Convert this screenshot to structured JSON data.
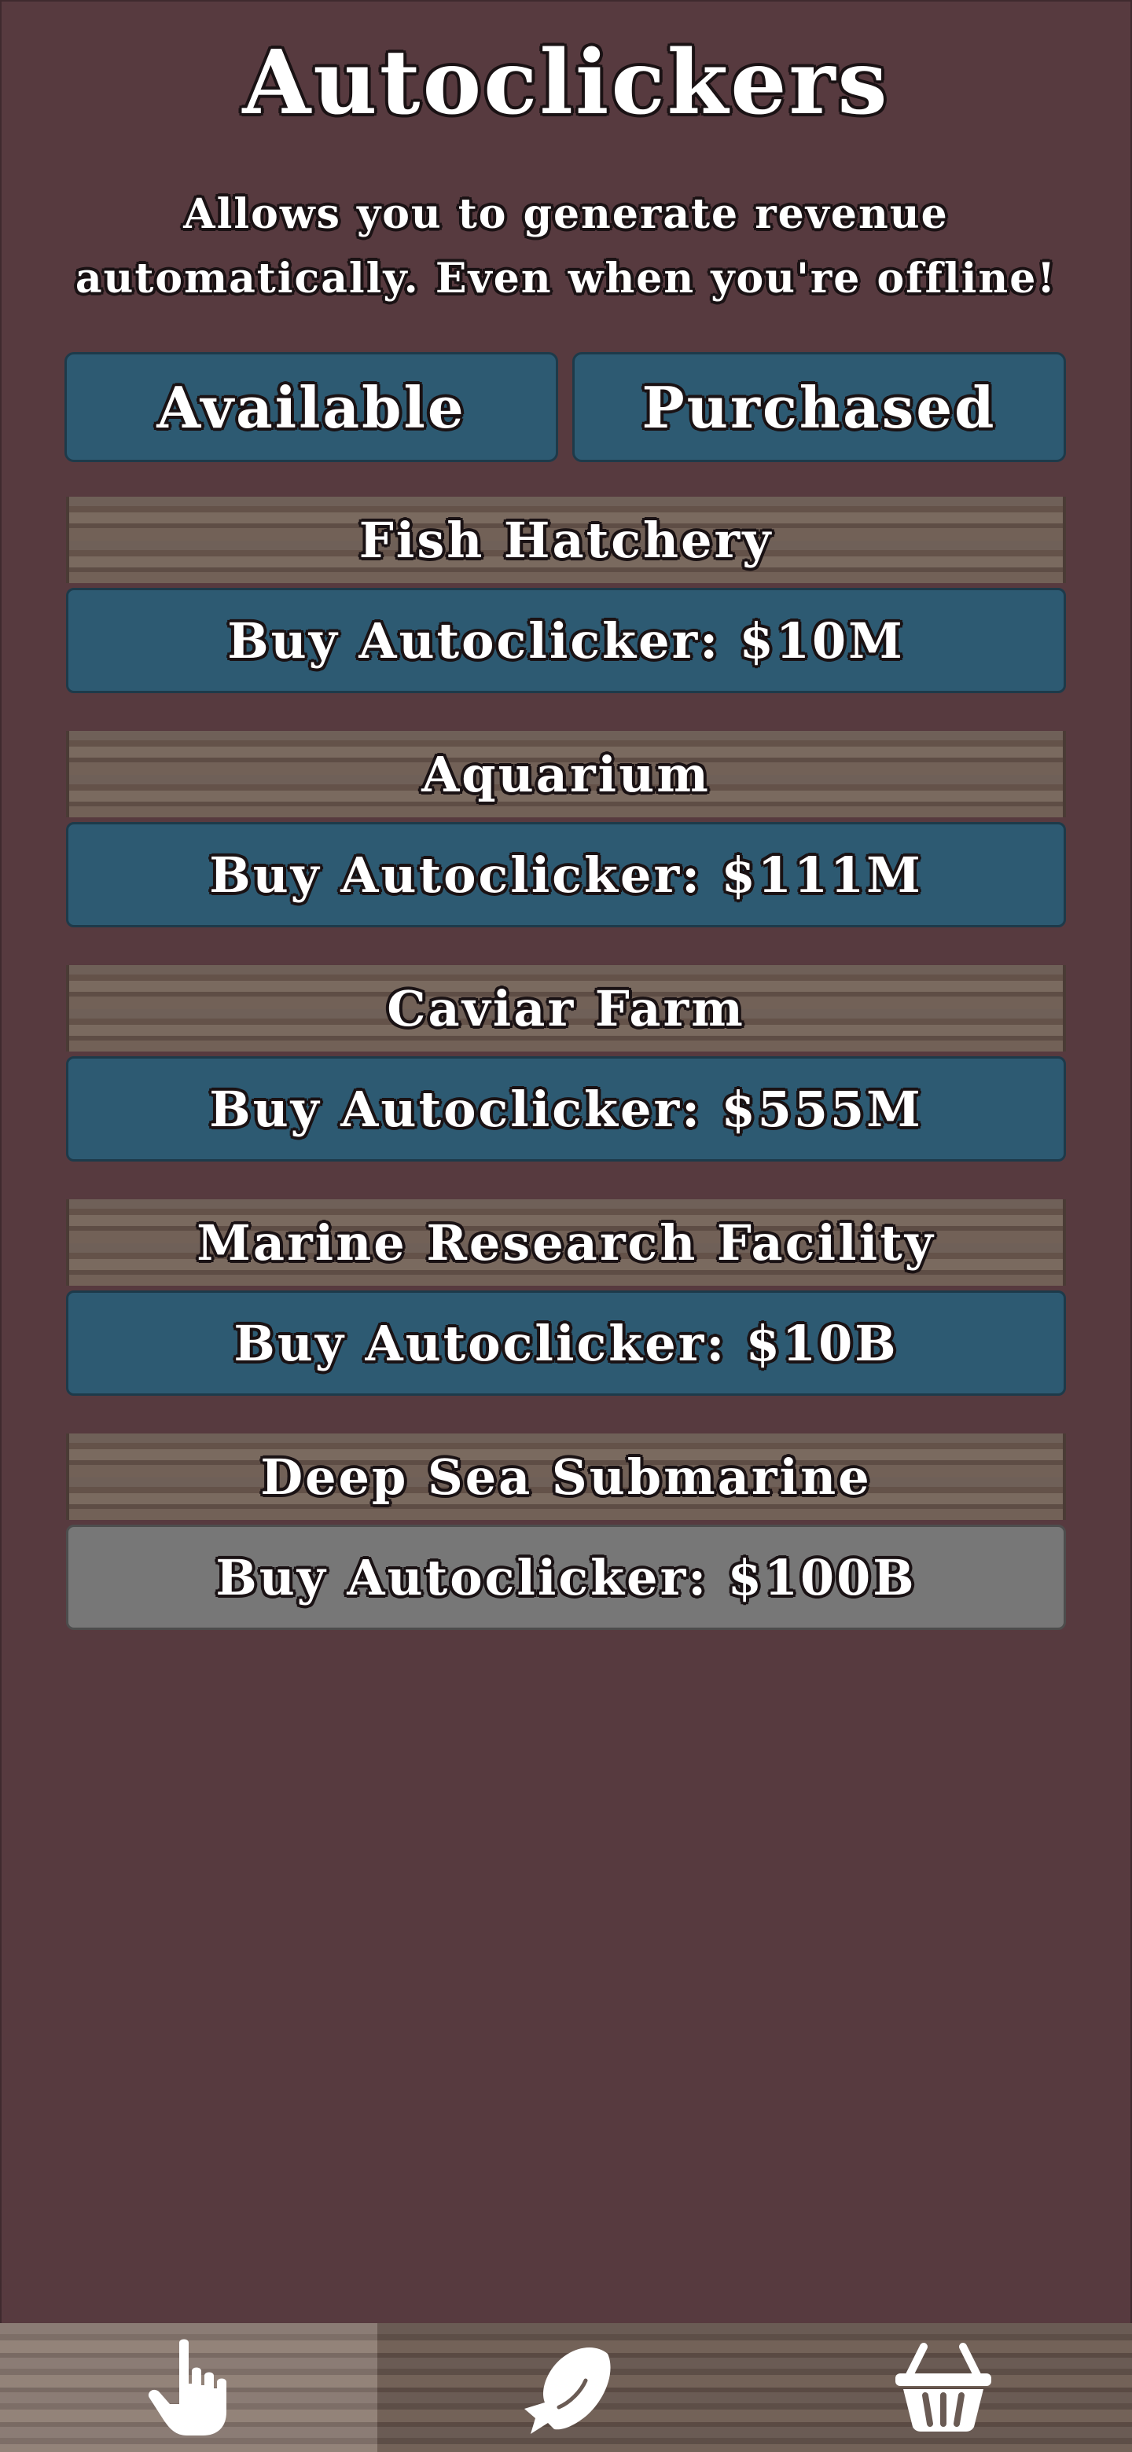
{
  "header": {
    "title": "Autoclickers",
    "description": "Allows you to generate revenue automatically. Even when you're offline!"
  },
  "tabs": [
    {
      "label": "Available",
      "active": true
    },
    {
      "label": "Purchased",
      "active": false
    }
  ],
  "items": [
    {
      "name": "Fish Hatchery",
      "button_label": "Buy Autoclicker: $10M",
      "enabled": true
    },
    {
      "name": "Aquarium",
      "button_label": "Buy Autoclicker: $111M",
      "enabled": true
    },
    {
      "name": "Caviar Farm",
      "button_label": "Buy Autoclicker: $555M",
      "enabled": true
    },
    {
      "name": "Marine Research Facility",
      "button_label": "Buy Autoclicker: $10B",
      "enabled": true
    },
    {
      "name": "Deep Sea Submarine",
      "button_label": "Buy Autoclicker: $100B",
      "enabled": false
    }
  ],
  "bottom_nav": [
    {
      "icon": "hand-pointer-icon",
      "active": true
    },
    {
      "icon": "fish-icon",
      "active": false
    },
    {
      "icon": "basket-icon",
      "active": false
    }
  ],
  "colors": {
    "background": "#573a3f",
    "button_blue": "#2d5a72",
    "button_disabled": "#777777",
    "wood": "#6f6058"
  }
}
